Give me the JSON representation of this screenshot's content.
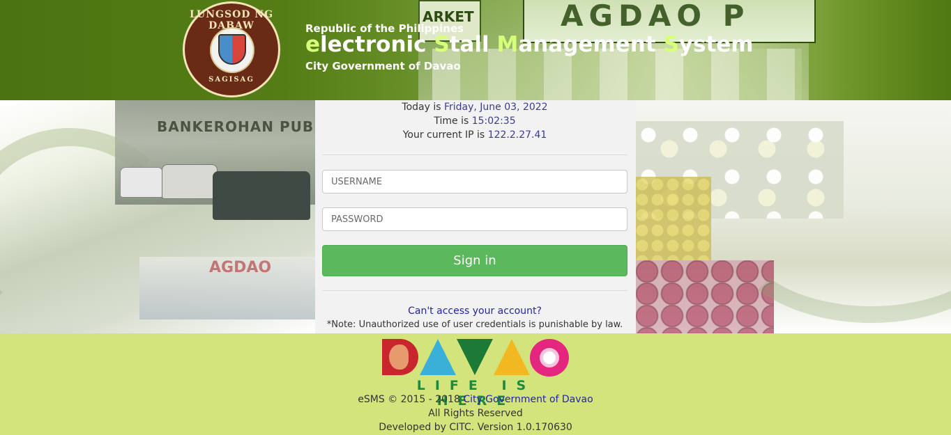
{
  "header": {
    "republic": "Republic of the Philippines",
    "title_parts": [
      {
        "text": "e",
        "highlight": true
      },
      {
        "text": "lectronic ",
        "highlight": false
      },
      {
        "text": "S",
        "highlight": true
      },
      {
        "text": "tall ",
        "highlight": false
      },
      {
        "text": "M",
        "highlight": true
      },
      {
        "text": "anagement ",
        "highlight": false
      },
      {
        "text": "S",
        "highlight": true
      },
      {
        "text": "ystem",
        "highlight": false
      }
    ],
    "city": "City Government of Davao",
    "seal_top": "LUNGSOD NG DABAW",
    "seal_bottom": "SAGISAG",
    "bg_sign_main": "AGDAO P",
    "bg_sign_left": "ARKET"
  },
  "background": {
    "left_sign": "BANKEROHAN PUBL",
    "left_bottom_sign": "AGDAO"
  },
  "login": {
    "today_label": "Today is ",
    "today_value": "Friday, June 03, 2022",
    "time_label": "Time is ",
    "time_value": "15:02:35",
    "ip_label": "Your current IP is ",
    "ip_value": "122.2.27.41",
    "username_placeholder": "USERNAME",
    "password_placeholder": "PASSWORD",
    "signin_label": "Sign in",
    "cant_access": "Can't access your account?",
    "note": "*Note: Unauthorized use of user credentials is punishable by law."
  },
  "footer": {
    "tagline": "LIFE IS HERE",
    "copyright_prefix": "eSMS © 2015 - 2018 ",
    "copyright_link": "City Government of Davao",
    "rights": "All Rights Reserved",
    "developed": "Developed by CITC. Version 1.0.170630"
  },
  "colors": {
    "header_green": "#4a7410",
    "title_highlight": "#d8ff7a",
    "signin_button": "#5cb85c",
    "footer_bg": "#d4e47c",
    "link_blue": "#2323a8"
  },
  "icons": {
    "seal": "city-seal-icon",
    "davao_logo": "davao-logo-icon"
  }
}
